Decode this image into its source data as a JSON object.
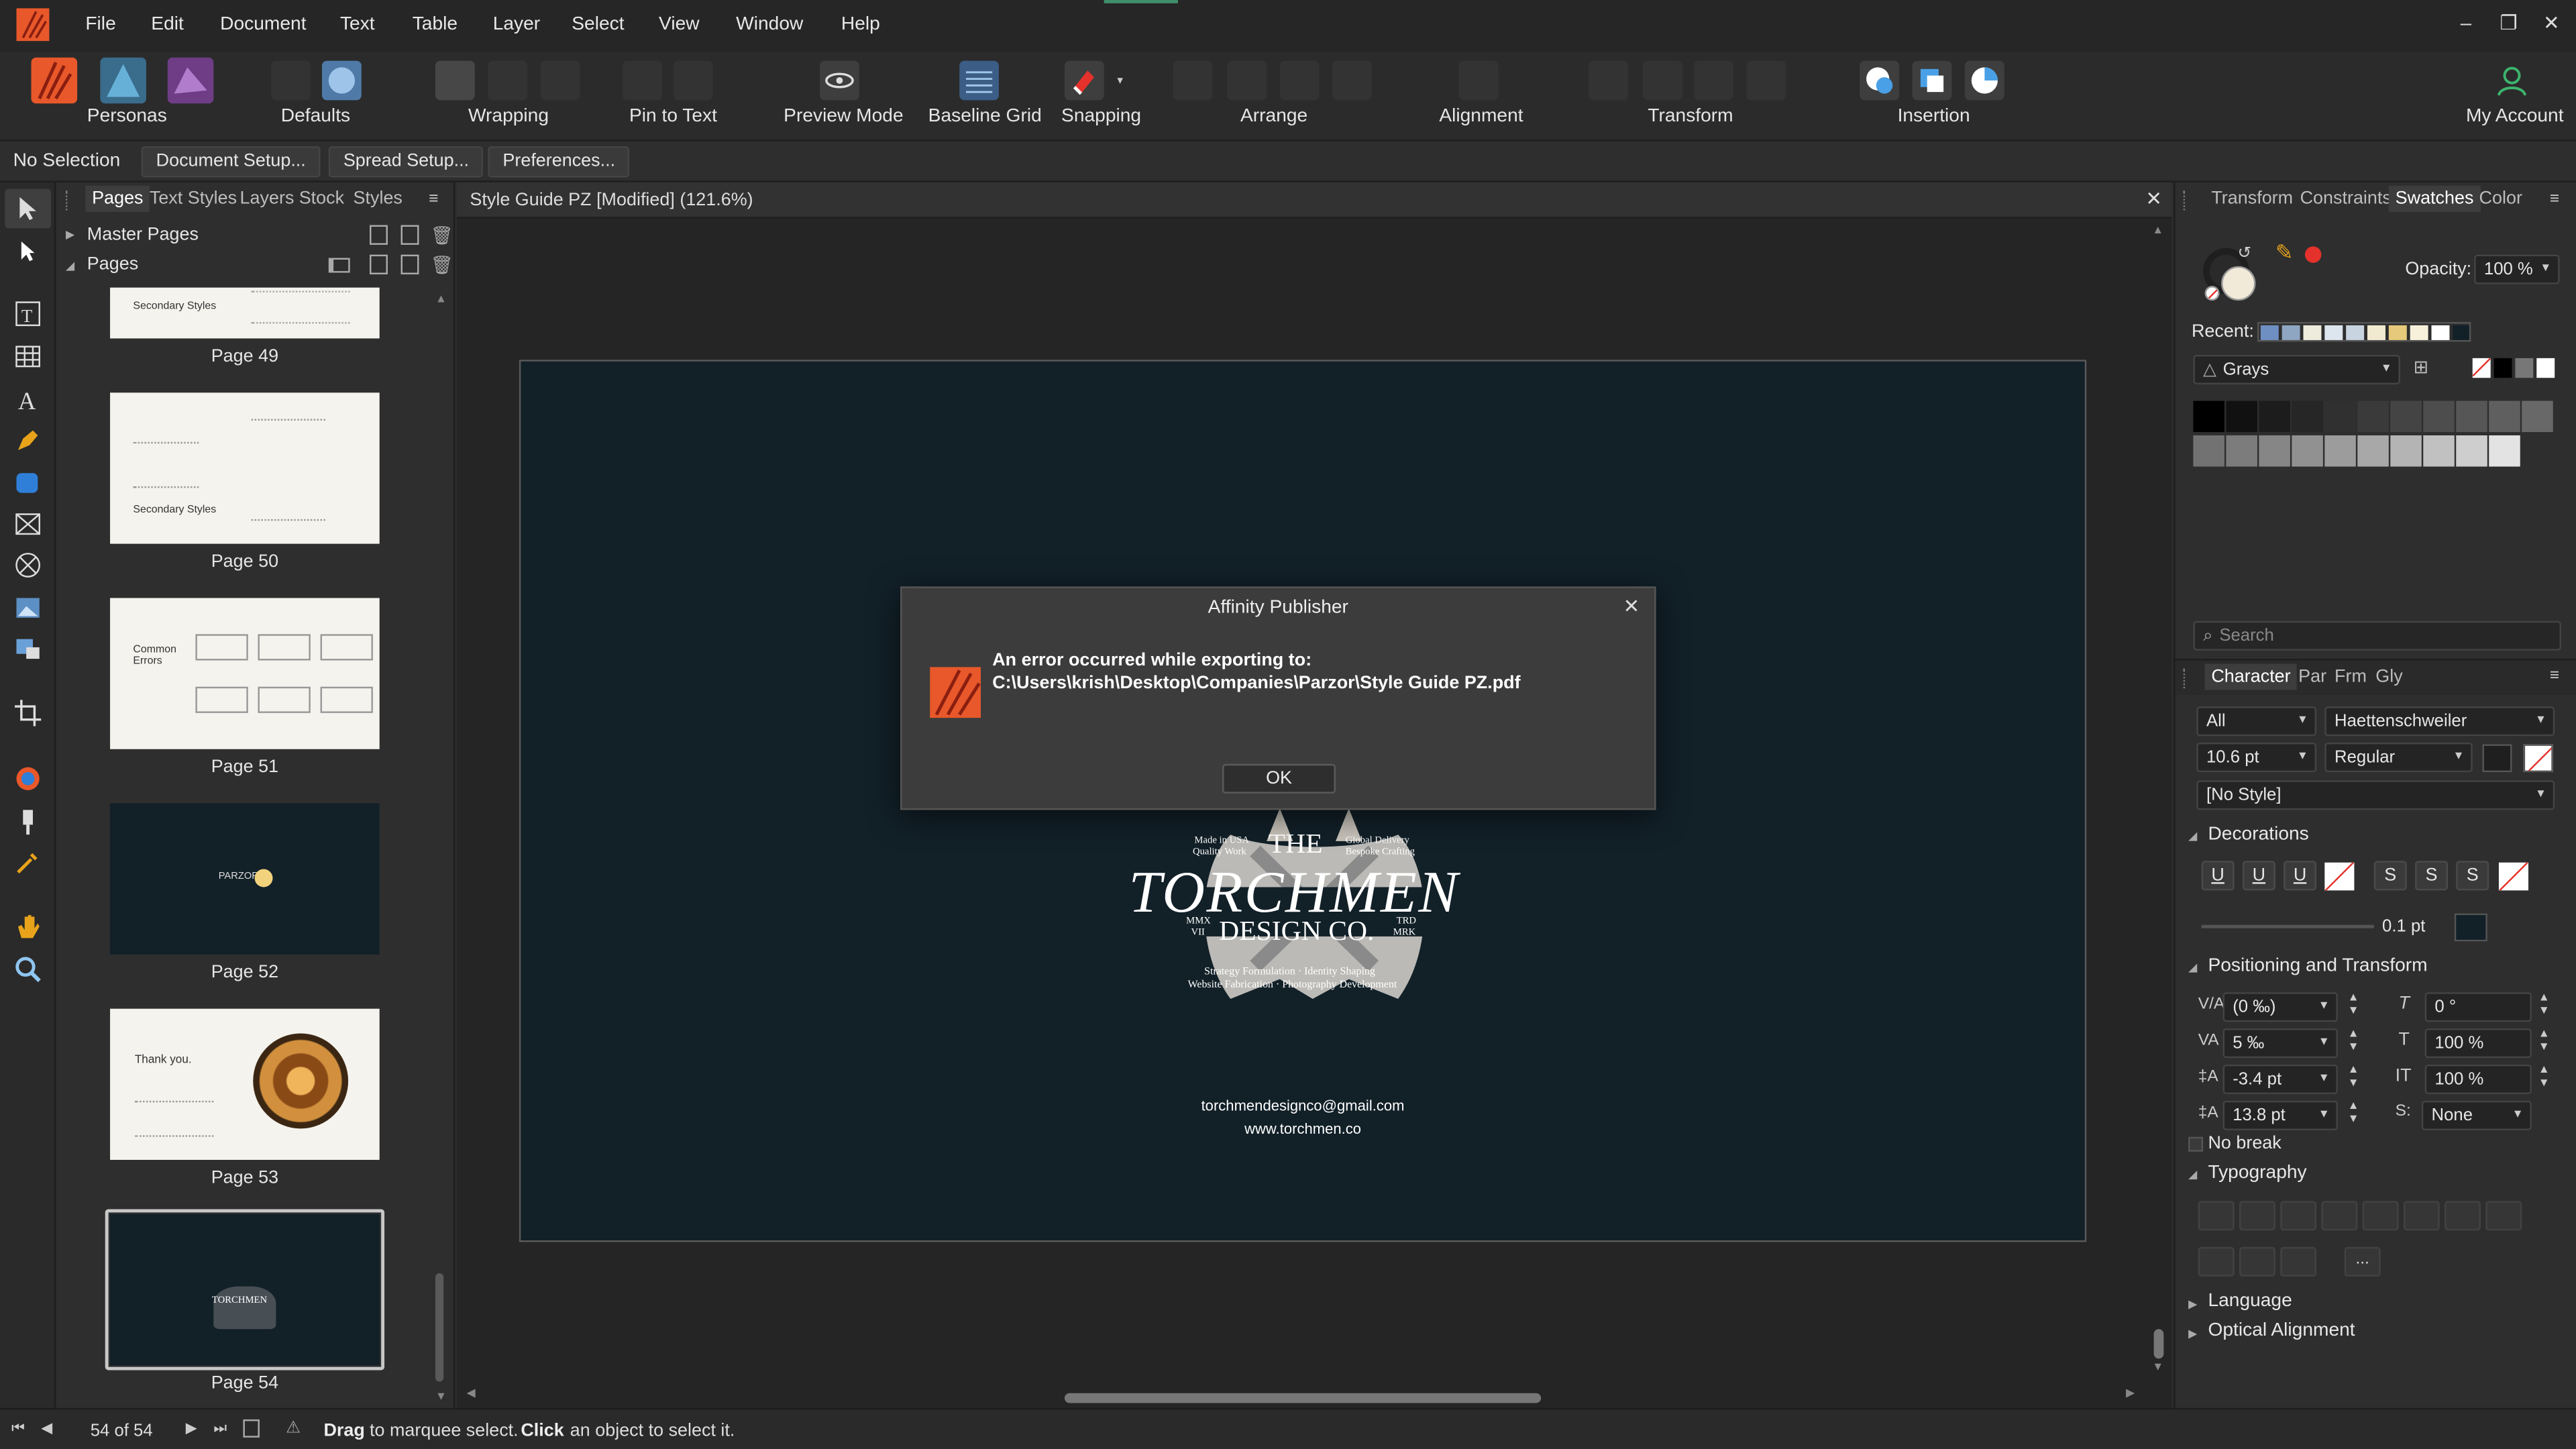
{
  "menubar": {
    "items": [
      "File",
      "Edit",
      "Document",
      "Text",
      "Table",
      "Layer",
      "Select",
      "View",
      "Window",
      "Help"
    ],
    "window_controls": {
      "minimize": "–",
      "restore": "❐",
      "close": "✕"
    }
  },
  "toolbar": {
    "personas_label": "Personas",
    "defaults_label": "Defaults",
    "wrapping_label": "Wrapping",
    "pin_to_text_label": "Pin to Text",
    "preview_mode_label": "Preview Mode",
    "baseline_grid_label": "Baseline Grid",
    "snapping_label": "Snapping",
    "arrange_label": "Arrange",
    "alignment_label": "Alignment",
    "transform_label": "Transform",
    "insertion_label": "Insertion",
    "my_account_label": "My Account"
  },
  "contextbar": {
    "selection_text": "No Selection",
    "document_setup": "Document Setup...",
    "spread_setup": "Spread Setup...",
    "preferences": "Preferences..."
  },
  "pages_panel": {
    "tabs": [
      "Pages",
      "Text Styles",
      "Layers",
      "Stock",
      "Styles"
    ],
    "master_pages": "Master Pages",
    "pages": "Pages",
    "thumbs": [
      {
        "label": "Page 49",
        "text": "Secondary Styles"
      },
      {
        "label": "Page 50",
        "text": "Secondary Styles"
      },
      {
        "label": "Page 51",
        "text": "Common Errors"
      },
      {
        "label": "Page 52",
        "text": "PARZOR"
      },
      {
        "label": "Page 53",
        "text": "Thank you."
      },
      {
        "label": "Page 54",
        "text": "TORCHMEN"
      }
    ]
  },
  "document": {
    "tab_title": "Style Guide PZ [Modified] (121.6%)",
    "logo": {
      "the": "THE",
      "name": "TORCHMEN",
      "design": "DESIGN CO.",
      "left_top": "Made in USA",
      "left_top2": "Quality Work",
      "right_top": "Global Delivery",
      "right_top2": "Bespoke Crafting",
      "left_mid": "MMX",
      "left_mid2": "VII",
      "right_mid": "TRD",
      "right_mid2": "MRK",
      "bottom1": "Strategy Formulation · Identity Shaping",
      "bottom2": "Website Fabrication · Photography Development"
    },
    "email": "torchmendesignco@gmail.com",
    "website": "www.torchmen.co"
  },
  "dialog": {
    "title": "Affinity Publisher",
    "message_line1": "An error occurred while exporting to:",
    "message_line2": "C:\\Users\\krish\\Desktop\\Companies\\Parzor\\Style Guide PZ.pdf",
    "ok_label": "OK"
  },
  "right_panel": {
    "tabs": [
      "Transform",
      "Constraints",
      "Swatches",
      "Color"
    ],
    "opacity_label": "Opacity:",
    "opacity_value": "100 %",
    "recent_label": "Recent:",
    "palette_name": "Grays",
    "search_placeholder": "Search",
    "char_tabs": [
      "Character",
      "Par",
      "Frm",
      "Gly"
    ],
    "char_all": "All",
    "font_family": "Haettenschweiler",
    "font_size": "10.6 pt",
    "font_style": "Regular",
    "no_style": "[No Style]",
    "decorations_label": "Decorations",
    "deco_stroke": "0.1 pt",
    "positioning_label": "Positioning and Transform",
    "kerning": "(0 ‰)",
    "tracking": "5 ‰",
    "baseline": "-3.4 pt",
    "leading": "13.8 pt",
    "shear": "0 °",
    "scale_v": "100 %",
    "scale_h": "100 %",
    "script": "None",
    "no_break": "No break",
    "typography_label": "Typography",
    "typography_more": "...",
    "language_label": "Language",
    "optical_alignment_label": "Optical Alignment"
  },
  "statusbar": {
    "page_counter": "54 of 54",
    "hint_drag": "Drag",
    "hint_mid": "to marquee select.",
    "hint_click": "Click",
    "hint_end": "an object to select it."
  },
  "colors": {
    "accent_orange": "#e8582a",
    "doc_bg": "#122028",
    "record_red": "#e5312b",
    "account_green": "#3db46d"
  }
}
